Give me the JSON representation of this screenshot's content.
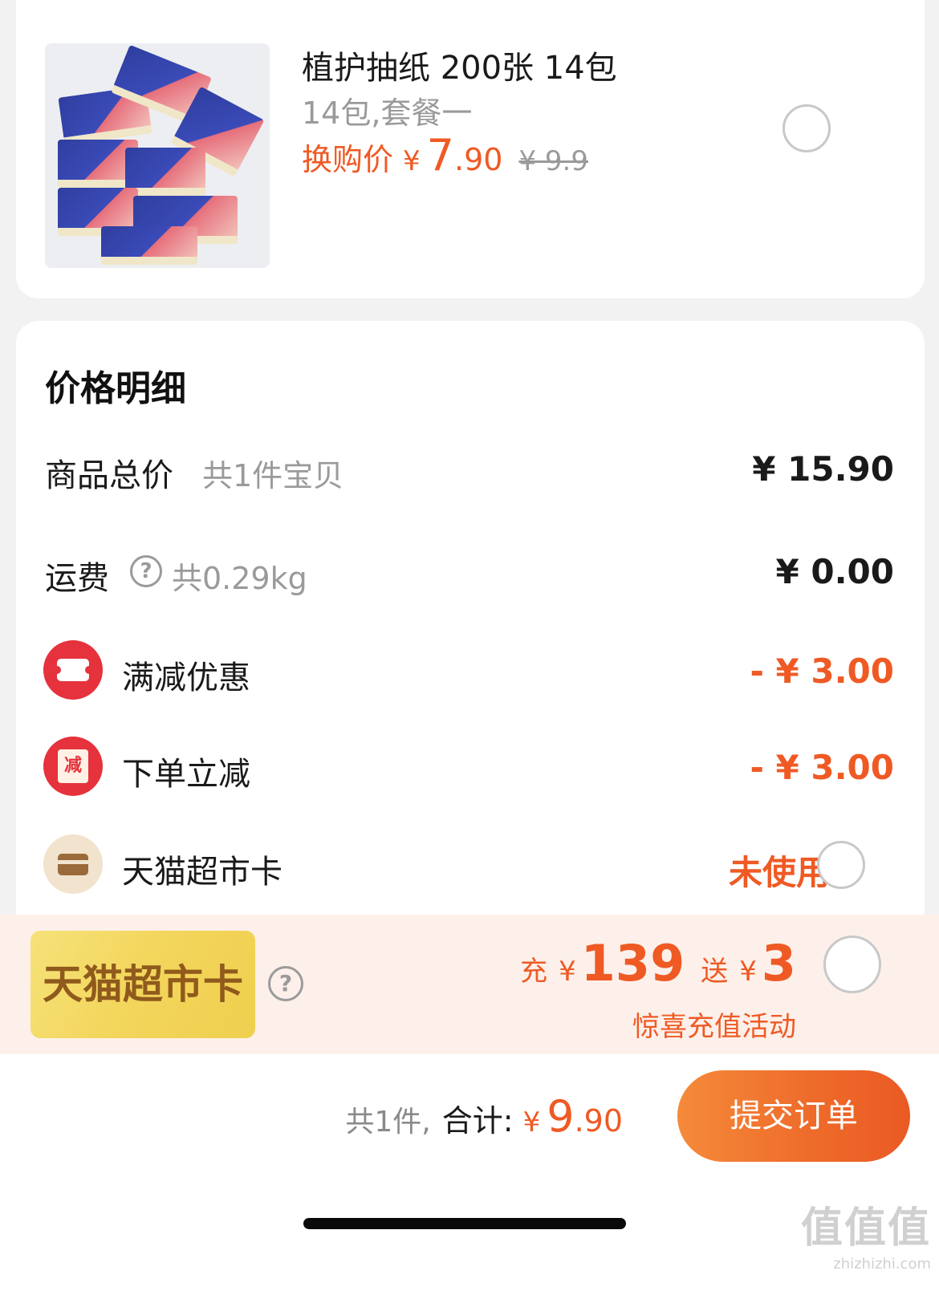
{
  "product": {
    "title": "植护抽纸 200张 14包",
    "variant": "14包,套餐一",
    "price_label": "换购价",
    "currency": "¥",
    "price_int": "7",
    "price_dec": ".90",
    "original_price": "¥ 9.9",
    "selected": false
  },
  "detail": {
    "title": "价格明细",
    "rows": {
      "subtotal": {
        "label": "商品总价",
        "sub": "共1件宝贝",
        "value": "¥ 15.90"
      },
      "shipping": {
        "label": "运费",
        "sub": "共0.29kg",
        "value": "¥ 0.00",
        "help_icon": "question-circle-icon"
      },
      "full_discount": {
        "label": "满减优惠",
        "value": "- ¥ 3.00",
        "icon": "ticket-icon"
      },
      "order_discount": {
        "label": "下单立减",
        "value": "- ¥ 3.00",
        "icon": "discount-envelope-icon",
        "icon_text": "减"
      },
      "market_card": {
        "label": "天猫超市卡",
        "value": "未使用",
        "icon": "card-icon"
      }
    }
  },
  "promo": {
    "card_text": "天猫超市卡",
    "charge_label": "充",
    "charge_yen": "¥",
    "charge_amount": "139",
    "gift_label": "送",
    "gift_yen": "¥",
    "gift_amount": "3",
    "subtitle": "惊喜充值活动",
    "help_icon": "question-circle-icon"
  },
  "footer": {
    "count_text": "共1件,",
    "total_label": "合计:",
    "currency": "¥",
    "total_int": "9",
    "total_dec": ".90",
    "submit_label": "提交订单"
  },
  "watermark": {
    "text": "值值值",
    "domain": "zhizhizhi.com"
  },
  "colors": {
    "accent": "#ef5a24",
    "discount_icon": "#e5323c",
    "promo_bg": "#fdf0ea",
    "promo_card": "#f3d65d"
  }
}
